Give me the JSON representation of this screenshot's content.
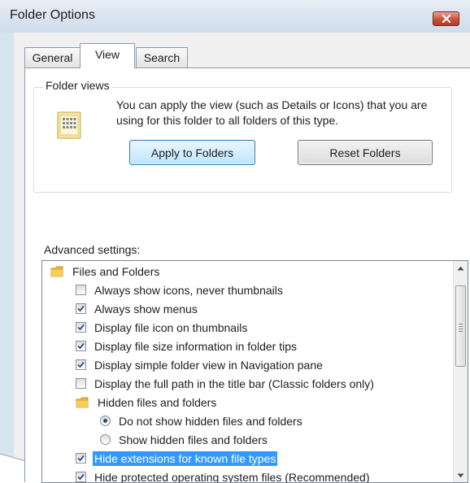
{
  "window": {
    "title": "Folder Options",
    "close_icon": "close-icon"
  },
  "tabs": [
    {
      "label": "General",
      "active": false
    },
    {
      "label": "View",
      "active": true
    },
    {
      "label": "Search",
      "active": false
    }
  ],
  "folder_views": {
    "legend": "Folder views",
    "description": "You can apply the view (such as Details or Icons) that you are using for this folder to all folders of this type.",
    "icon": "folder-view-icon",
    "apply_button": "Apply to Folders",
    "reset_button": "Reset Folders"
  },
  "advanced": {
    "label": "Advanced settings:",
    "items": [
      {
        "type": "folder",
        "label": "Files and Folders",
        "level": 0
      },
      {
        "type": "checkbox",
        "label": "Always show icons, never thumbnails",
        "checked": false,
        "level": 1
      },
      {
        "type": "checkbox",
        "label": "Always show menus",
        "checked": true,
        "level": 1
      },
      {
        "type": "checkbox",
        "label": "Display file icon on thumbnails",
        "checked": true,
        "level": 1
      },
      {
        "type": "checkbox",
        "label": "Display file size information in folder tips",
        "checked": true,
        "level": 1
      },
      {
        "type": "checkbox",
        "label": "Display simple folder view in Navigation pane",
        "checked": true,
        "level": 1
      },
      {
        "type": "checkbox",
        "label": "Display the full path in the title bar (Classic folders only)",
        "checked": false,
        "level": 1
      },
      {
        "type": "folder",
        "label": "Hidden files and folders",
        "level": 1
      },
      {
        "type": "radio",
        "label": "Do not show hidden files and folders",
        "checked": true,
        "level": 2
      },
      {
        "type": "radio",
        "label": "Show hidden files and folders",
        "checked": false,
        "level": 2
      },
      {
        "type": "checkbox",
        "label": "Hide extensions for known file types",
        "checked": true,
        "level": 1,
        "selected": true
      },
      {
        "type": "checkbox",
        "label": "Hide protected operating system files (Recommended)",
        "checked": true,
        "level": 1
      }
    ]
  },
  "colors": {
    "selection": "#3399ff",
    "title_bar": "#cfdcea",
    "close_button": "#c9523c",
    "apply_border": "#3c7fb1"
  }
}
